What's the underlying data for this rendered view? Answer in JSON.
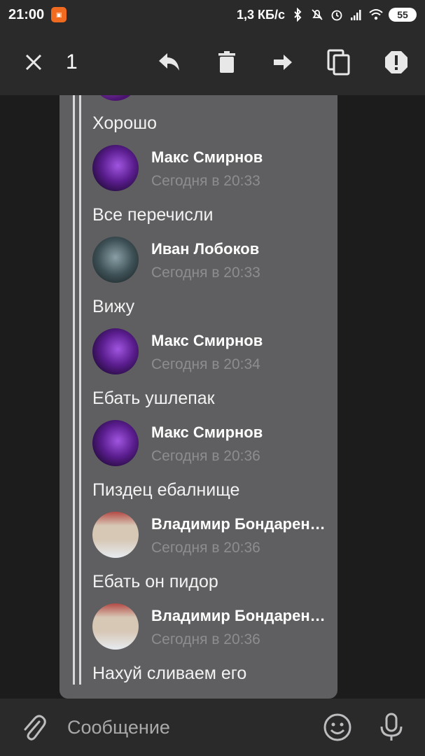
{
  "status_bar": {
    "time": "21:00",
    "app_icon": "notification-app-icon",
    "net_speed": "1,3 КБ/с",
    "battery": "55"
  },
  "toolbar": {
    "selected_count": "1"
  },
  "thread": [
    {
      "text": "Хорошо",
      "sender": "Макс Смирнов",
      "time": "Сегодня в 20:33",
      "avatar": "purple"
    },
    {
      "text": "Все перечисли",
      "sender": "Иван Лобоков",
      "time": "Сегодня в 20:33",
      "avatar": "dark"
    },
    {
      "text": "Вижу",
      "sender": "Макс Смирнов",
      "time": "Сегодня в 20:34",
      "avatar": "purple"
    },
    {
      "text": "Ебать ушлепак",
      "sender": "Макс Смирнов",
      "time": "Сегодня в 20:36",
      "avatar": "purple"
    },
    {
      "text": "Пиздец ебалнище",
      "sender": "Владимир Бондаренко",
      "time": "Сегодня в 20:36",
      "avatar": "person"
    },
    {
      "text": "Ебать он пидор",
      "sender": "Владимир Бондаренко",
      "time": "Сегодня в 20:36",
      "avatar": "person"
    }
  ],
  "last_message": "Нахуй сливаем его",
  "composer": {
    "placeholder": "Сообщение"
  },
  "colors": {
    "bar_bg": "#2a2a2b",
    "page_bg": "#1c1c1d",
    "bubble_bg": "#5f5f61",
    "timestamp": "#8d8d90"
  }
}
